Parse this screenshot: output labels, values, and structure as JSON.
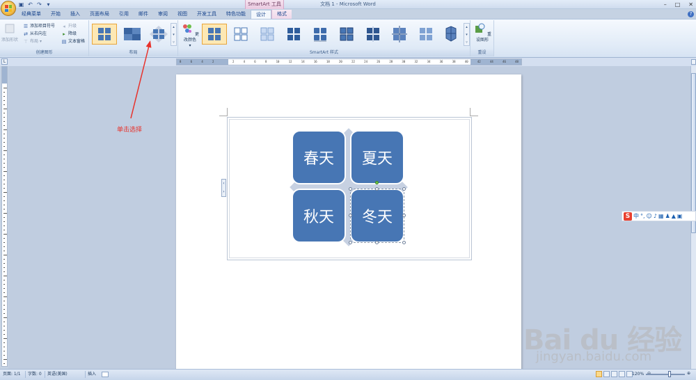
{
  "title_bar": {
    "doc_title": "文档 1 - Microsoft Word",
    "context_title": "SmartArt 工具",
    "controls": [
      "–",
      "□",
      "✕"
    ]
  },
  "tabs": [
    {
      "label": "经典菜单"
    },
    {
      "label": "开始"
    },
    {
      "label": "插入"
    },
    {
      "label": "页面布局"
    },
    {
      "label": "引用"
    },
    {
      "label": "邮件"
    },
    {
      "label": "审阅"
    },
    {
      "label": "视图"
    },
    {
      "label": "开发工具"
    },
    {
      "label": "特色功能"
    },
    {
      "label": "设计"
    },
    {
      "label": "格式"
    }
  ],
  "ribbon": {
    "create_graphic": {
      "label": "创建图形",
      "add_shape": "添加形状",
      "add_bullet": "添加项目符号",
      "right_to_left": "从右向左",
      "layout": "布局",
      "promote": "升级",
      "demote": "降级",
      "text_pane": "文本窗格"
    },
    "layouts": {
      "label": "布局"
    },
    "styles": {
      "label": "SmartArt 样式",
      "change_colors": "更改颜色"
    },
    "reset": {
      "label": "重设",
      "reset_graphic": "重设图形"
    }
  },
  "ruler": {
    "ticks": [
      "8",
      "6",
      "4",
      "2",
      "",
      "2",
      "4",
      "6",
      "8",
      "10",
      "12",
      "14",
      "16",
      "18",
      "20",
      "22",
      "24",
      "26",
      "28",
      "30",
      "32",
      "34",
      "36",
      "38",
      "40",
      "42",
      "44",
      "46",
      "48"
    ]
  },
  "diagram": {
    "tiles": [
      {
        "label": "春天"
      },
      {
        "label": "夏天"
      },
      {
        "label": "秋天"
      },
      {
        "label": "冬天"
      }
    ],
    "colors": {
      "tile": "#4776b4",
      "diamond": "#c7d1e2"
    }
  },
  "annotation": {
    "text": "单击选择",
    "color": "#e8312a"
  },
  "ime": {
    "logo": "S",
    "mode": "中"
  },
  "watermark": {
    "brand": "Bai du 经验",
    "url": "jingyan.baidu.com"
  },
  "status": {
    "page": "页面: 1/1",
    "words": "字数: 0",
    "language": "英语(美国)",
    "insert": "插入",
    "zoom": "120%"
  }
}
